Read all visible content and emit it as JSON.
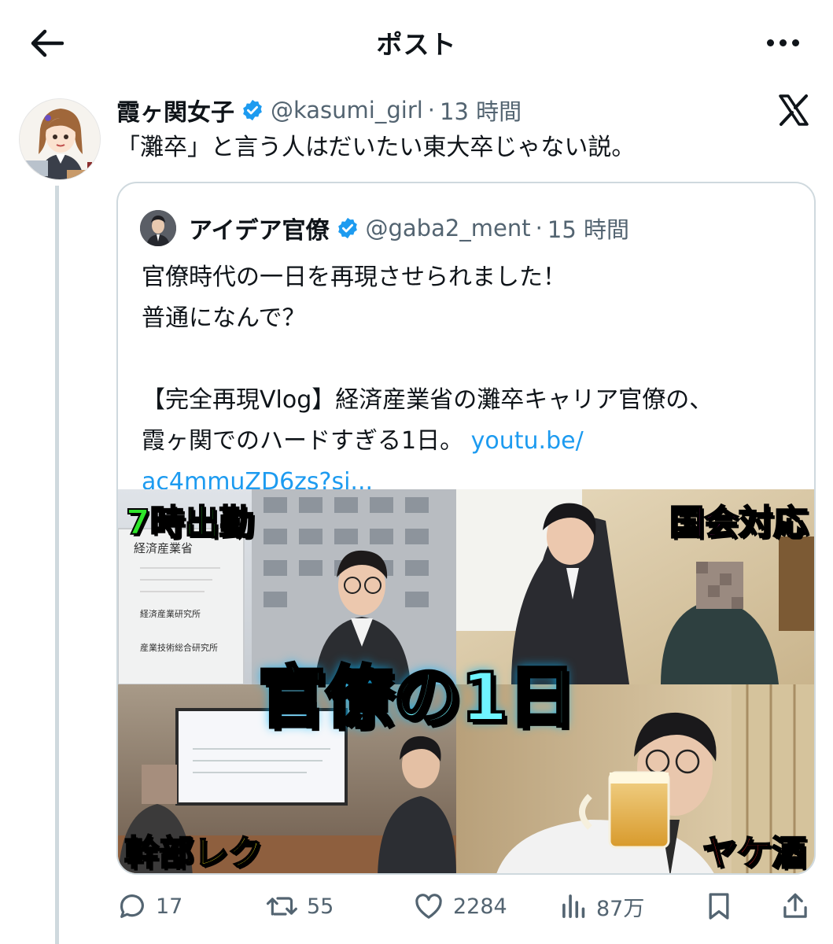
{
  "header": {
    "title": "ポスト",
    "back_icon": "arrow-left-icon",
    "more_icon": "more-dots-icon"
  },
  "post": {
    "display_name": "霞ヶ関女子",
    "handle": "@kasumi_girl",
    "separator": "·",
    "time": "13 時間",
    "text": "「灘卒」と言う人はだいたい東大卒じゃない説。"
  },
  "quote": {
    "display_name": "アイデア官僚",
    "handle": "@gaba2_ment",
    "separator": "·",
    "time": "15 時間",
    "lines": [
      "官僚時代の一日を再現させられました！",
      "普通になんで？",
      "",
      "【完全再現Vlog】経済産業省の灘卒キャリア官僚の、",
      "霞ヶ関でのハードすぎる1日。"
    ],
    "link_part1": "youtu.be/",
    "link_part2": "ac4mmuZD6zs?si...",
    "thumbnail": {
      "label_top_left": "7時出勤",
      "label_top_right": "国会対応",
      "label_center": "官僚の1日",
      "label_bottom_left": "幹部レク",
      "label_bottom_right": "ヤケ酒",
      "sign_text_1": "経済産業省",
      "sign_text_2": "経済産業研究所",
      "sign_text_3": "産業技術総合研究所"
    }
  },
  "actions": {
    "replies": "17",
    "reposts": "55",
    "likes": "2284",
    "views": "87万"
  },
  "colors": {
    "link": "#1d9bf0",
    "verified": "#1d9bf0",
    "muted": "#536471",
    "border": "#cfd9de"
  }
}
